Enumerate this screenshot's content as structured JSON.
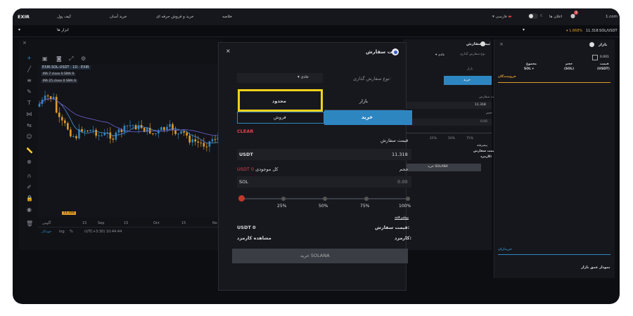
{
  "topnav": {
    "logo": "EXIR",
    "links": [
      "کیف پول",
      "خرید آسان",
      "خرید و فروش حرفه ای",
      "خلاصه"
    ],
    "right_domain": "1.com",
    "notifications_label": "اعلان ها",
    "notif_count": "3",
    "language": "فارسی"
  },
  "subbar": {
    "tools_label": "ابزار ها",
    "pair_label": "11.318:SOL/USDT",
    "change": "1.668%"
  },
  "chart": {
    "header": "EXIR:SOL-USDT · 1D · EXIR",
    "ma7_label": "MA 7 close 0 SMA 9",
    "ma25_label": "MA 25 close 0 SMA 9",
    "price_tag": "11.318",
    "x_ticks": [
      "آگوس",
      "15",
      "Sep",
      "15",
      "Oct",
      "15",
      "No"
    ],
    "footer_log": "log",
    "footer_pct": "%",
    "footer_time": "(UTC+3:30) 10:44:44",
    "footer_auto": "خودکار"
  },
  "modal": {
    "title": "ثبت سفارش",
    "order_type_label": "نوع سفارش گذاری:",
    "order_type_value": "عادی",
    "tab_market": "بازار",
    "tab_limit": "محدود",
    "btn_buy": "خرید",
    "btn_sell": "فروش",
    "clear": "CLEAR",
    "price_label": "قیمت سفارش",
    "price_currency": "USDT",
    "price_value": "11.318",
    "volume_label": "حجم",
    "balance_label": "کل موجودی",
    "balance_value": "USDT 0",
    "volume_currency": "SOL",
    "volume_value": "0.00",
    "slider_marks": [
      "25%",
      "50%",
      "75%",
      "100%"
    ],
    "preview_label": "پیشرفته",
    "order_price_label": "قیمت سفارش:",
    "order_price_value": "USDT 0",
    "fee_label": "کارمزد:",
    "fee_value": "مشاهده کارمزد",
    "submit": "خرید SOLANA"
  },
  "side_mid": {
    "title": "ثبت سفارش",
    "order_type_label": "نوع سفارش گذاری",
    "order_type_value": "عادی",
    "tab_market": "بازار",
    "btn_buy": "خرید",
    "price_label": "قیمت سفارش",
    "price_value": "11.318",
    "volume_label": "حجم",
    "volume_value": "0.00",
    "slider_marks": [
      "25%",
      "50%",
      "75%"
    ],
    "preview_label": "پیشرفته",
    "order_price_label": "قیمت سفارش:",
    "fee_label": "کارمزد:",
    "submit": "خرید SOLANA"
  },
  "orderbook": {
    "title": "بازار",
    "tick_value": "0.001",
    "col_price": "قیمت",
    "col_price_unit": "(USDT)",
    "col_volume": "حجم",
    "col_volume_unit": "(SOL)",
    "col_total": "مجموع",
    "col_total_unit": "SOL",
    "sellers": "فروشندگان",
    "buyers": "خریداران",
    "depth_chart": "نمودار عمق بازار"
  },
  "colors": {
    "buy": "#2e86c1",
    "sell_red": "#e0444f",
    "highlight": "#f2d21b",
    "accent_orange": "#e09a2a"
  }
}
